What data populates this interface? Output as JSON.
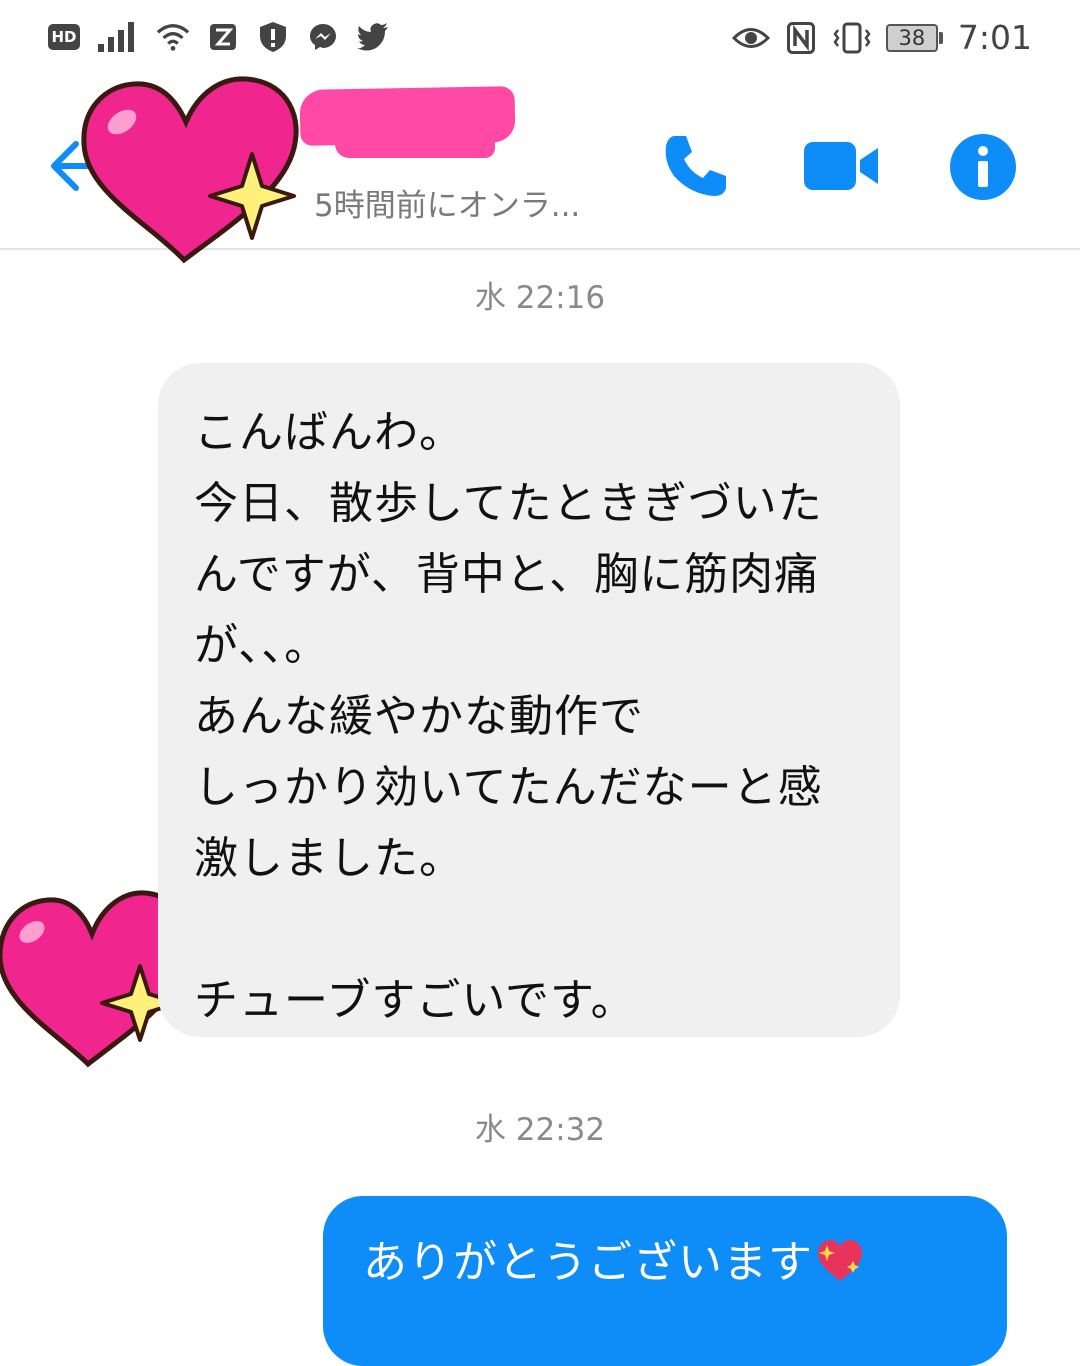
{
  "status_bar": {
    "hd_label": "HD",
    "battery_level": "38",
    "time": "7:01",
    "left_icons": [
      "signal-icon",
      "wifi-icon",
      "app-icon",
      "shield-icon",
      "messenger-icon",
      "twitter-icon"
    ],
    "right_icons": [
      "eye-icon",
      "nfc-icon",
      "vibrate-icon",
      "battery-icon"
    ]
  },
  "header": {
    "contact_status": "5時間前にオンラ...",
    "actions": [
      "back-icon",
      "phone-icon",
      "video-icon",
      "info-icon"
    ],
    "accent_color": "#0e8cf8",
    "redaction_color": "#ff49a4"
  },
  "thread": {
    "timestamp_1": "水 22:16",
    "incoming_message": "こんばんわ。\n今日、散歩してたときぎづいた\nんですが、背中と、胸に筋肉痛\nが、、。\nあんな緩やかな動作で\nしっかり効いてたんだなーと感\n激しました。\n\nチューブすごいです。",
    "timestamp_2": "水 22:32",
    "outgoing_message": "ありがとうございます",
    "outgoing_emoji": "sparkling-heart-icon"
  },
  "colors": {
    "incoming_bubble": "#f0f0f0",
    "outgoing_bubble": "#0e8cf8",
    "sticker_heart": "#f0258e"
  }
}
